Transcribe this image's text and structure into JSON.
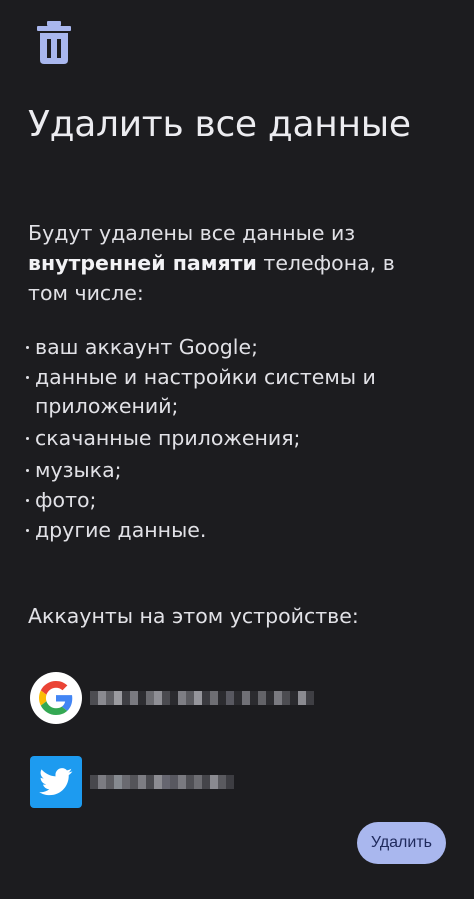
{
  "header": {
    "icon": "trash-icon",
    "icon_color": "#a9b7ee",
    "title": "Удалить все данные"
  },
  "description": {
    "part1": "Будут удалены все данные из ",
    "bold": "внутренней памяти",
    "part2": " телефона, в том числе:"
  },
  "items": [
    "ваш аккаунт Google;",
    "данные и настройки системы и приложений;",
    "скачанные приложения;",
    "музыка;",
    "фото;",
    "другие данные."
  ],
  "accounts": {
    "title": "Аккаунты на этом устройстве:",
    "list": [
      {
        "icon": "google-icon"
      },
      {
        "icon": "twitter-icon"
      }
    ]
  },
  "action": {
    "delete_label": "Удалить",
    "color": "#a9b7ee"
  }
}
